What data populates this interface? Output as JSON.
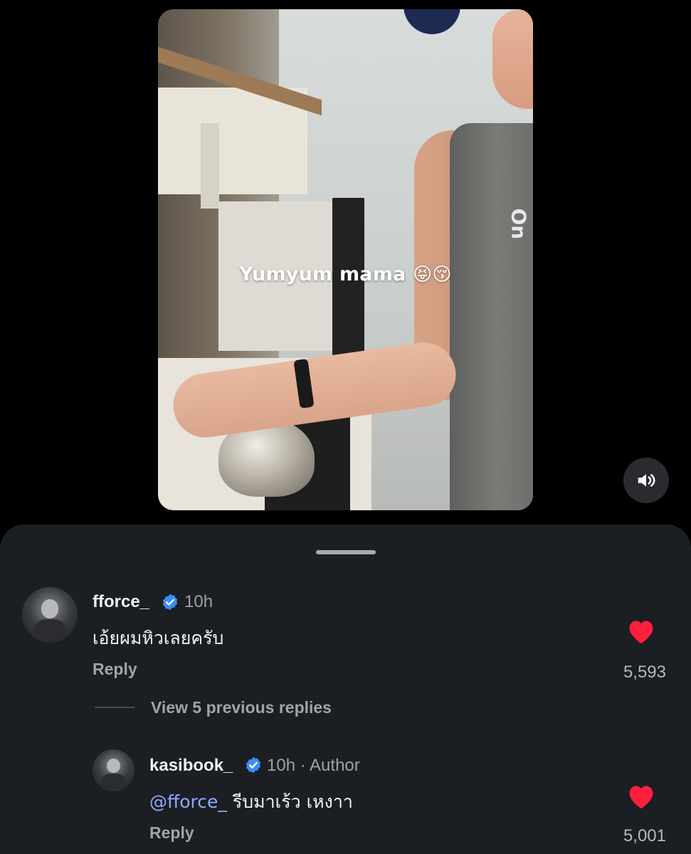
{
  "story": {
    "caption_text": "Yumyum mama",
    "caption_emoji_1": "😝",
    "caption_emoji_2": "😚",
    "shirt_logo_text": "On",
    "sound_icon": "speaker-icon"
  },
  "comments": [
    {
      "username": "fforce_",
      "verified": true,
      "time": "10h",
      "text": "เอ้ยผมหิวเลยครับ",
      "reply_label": "Reply",
      "likes": "5,593",
      "liked": true
    },
    {
      "username": "kasibook_",
      "verified": true,
      "time": "10h · Author",
      "mention": "@fforce_",
      "text": "รีบมาเร้ว เหงาา",
      "reply_label": "Reply",
      "likes": "5,001",
      "liked": true
    }
  ],
  "thread": {
    "view_replies_label": "View 5 previous replies"
  },
  "colors": {
    "background": "#000000",
    "sheet": "#1b1e22",
    "like_red": "#ff1f3d",
    "verified_blue": "#3a8df5",
    "mention_blue": "#8fa9ff"
  }
}
